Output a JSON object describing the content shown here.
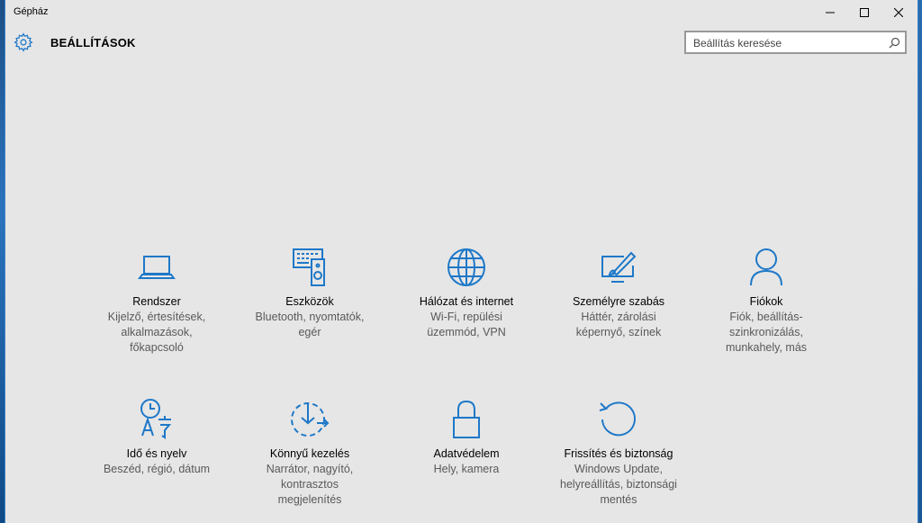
{
  "window": {
    "title": "Gépház"
  },
  "header": {
    "title": "BEÁLLÍTÁSOK"
  },
  "search": {
    "placeholder": "Beállítás keresése"
  },
  "tiles": [
    {
      "icon": "laptop-icon",
      "name": "Rendszer",
      "desc": "Kijelző, értesítések, alkalmazások, főkapcsoló"
    },
    {
      "icon": "devices-icon",
      "name": "Eszközök",
      "desc": "Bluetooth, nyomtatók, egér"
    },
    {
      "icon": "globe-icon",
      "name": "Hálózat és internet",
      "desc": "Wi-Fi, repülési üzemmód, VPN"
    },
    {
      "icon": "personalize-icon",
      "name": "Személyre szabás",
      "desc": "Háttér, zárolási képernyő, színek"
    },
    {
      "icon": "person-icon",
      "name": "Fiókok",
      "desc": "Fiók, beállítás-szinkronizálás, munkahely, más"
    },
    {
      "icon": "time-language-icon",
      "name": "Idő és nyelv",
      "desc": "Beszéd, régió, dátum"
    },
    {
      "icon": "ease-of-access-icon",
      "name": "Könnyű kezelés",
      "desc": "Narrátor, nagyító, kontrasztos megjelenítés"
    },
    {
      "icon": "lock-icon",
      "name": "Adatvédelem",
      "desc": "Hely, kamera"
    },
    {
      "icon": "update-icon",
      "name": "Frissítés és biztonság",
      "desc": "Windows Update, helyreállítás, biztonsági mentés"
    }
  ],
  "colors": {
    "accent": "#1e78c8",
    "background": "#e6e6e6"
  }
}
